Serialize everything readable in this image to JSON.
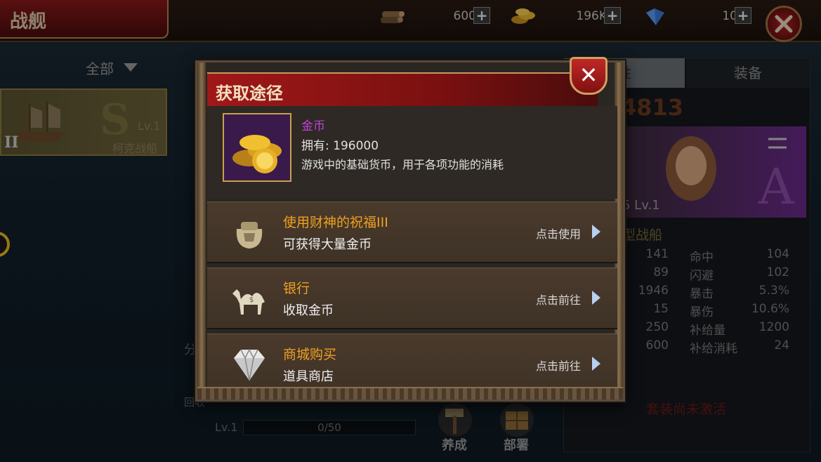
{
  "header": {
    "title": "战舰",
    "resources": [
      {
        "icon": "wood-icon",
        "value": "600"
      },
      {
        "icon": "gold-coins-icon",
        "value": "196K"
      },
      {
        "icon": "diamond-icon",
        "value": "10"
      }
    ]
  },
  "left": {
    "filter_label": "全部",
    "ship": {
      "grade": "S",
      "level": "Lv.1",
      "name": "柯克战船",
      "tier": "II"
    },
    "side_text_1": "分",
    "side_text_2": "回收"
  },
  "bottom": {
    "level_label": "Lv.1",
    "progress": "0/50",
    "progress_fraction": 0,
    "buttons": [
      {
        "label": "养成",
        "icon": "hammer-icon"
      },
      {
        "label": "部署",
        "icon": "crate-icon"
      }
    ]
  },
  "right_panel": {
    "tabs": [
      "性",
      "装备"
    ],
    "power": "4813",
    "hero_level": "5 Lv.1",
    "hero_grade": "A",
    "ship_type": "型战船",
    "stats": [
      {
        "v1": "141",
        "label": "命中",
        "v2": "104"
      },
      {
        "v1": "89",
        "label": "闪避",
        "v2": "102"
      },
      {
        "v1": "1946",
        "label": "暴击",
        "v2": "5.3%"
      },
      {
        "v1": "15",
        "label": "暴伤",
        "v2": "10.6%"
      },
      {
        "v1": "250",
        "label": "补给量",
        "v2": "1200"
      },
      {
        "v1": "600",
        "label": "补给消耗",
        "v2": "24"
      }
    ],
    "set_status": "套装尚未激活"
  },
  "modal": {
    "title": "获取途径",
    "item": {
      "name": "金币",
      "owned": "拥有: 196000",
      "description": "游戏中的基础货币，用于各项功能的消耗"
    },
    "sources": [
      {
        "title": "使用财神的祝福III",
        "subtitle": "可获得大量金币",
        "action": "点击使用",
        "icon": "money-bag-icon"
      },
      {
        "title": "银行",
        "subtitle": "收取金币",
        "action": "点击前往",
        "icon": "camel-icon"
      },
      {
        "title": "商城购买",
        "subtitle": "道具商店",
        "action": "点击前往",
        "icon": "diamond-gem-icon"
      }
    ]
  }
}
